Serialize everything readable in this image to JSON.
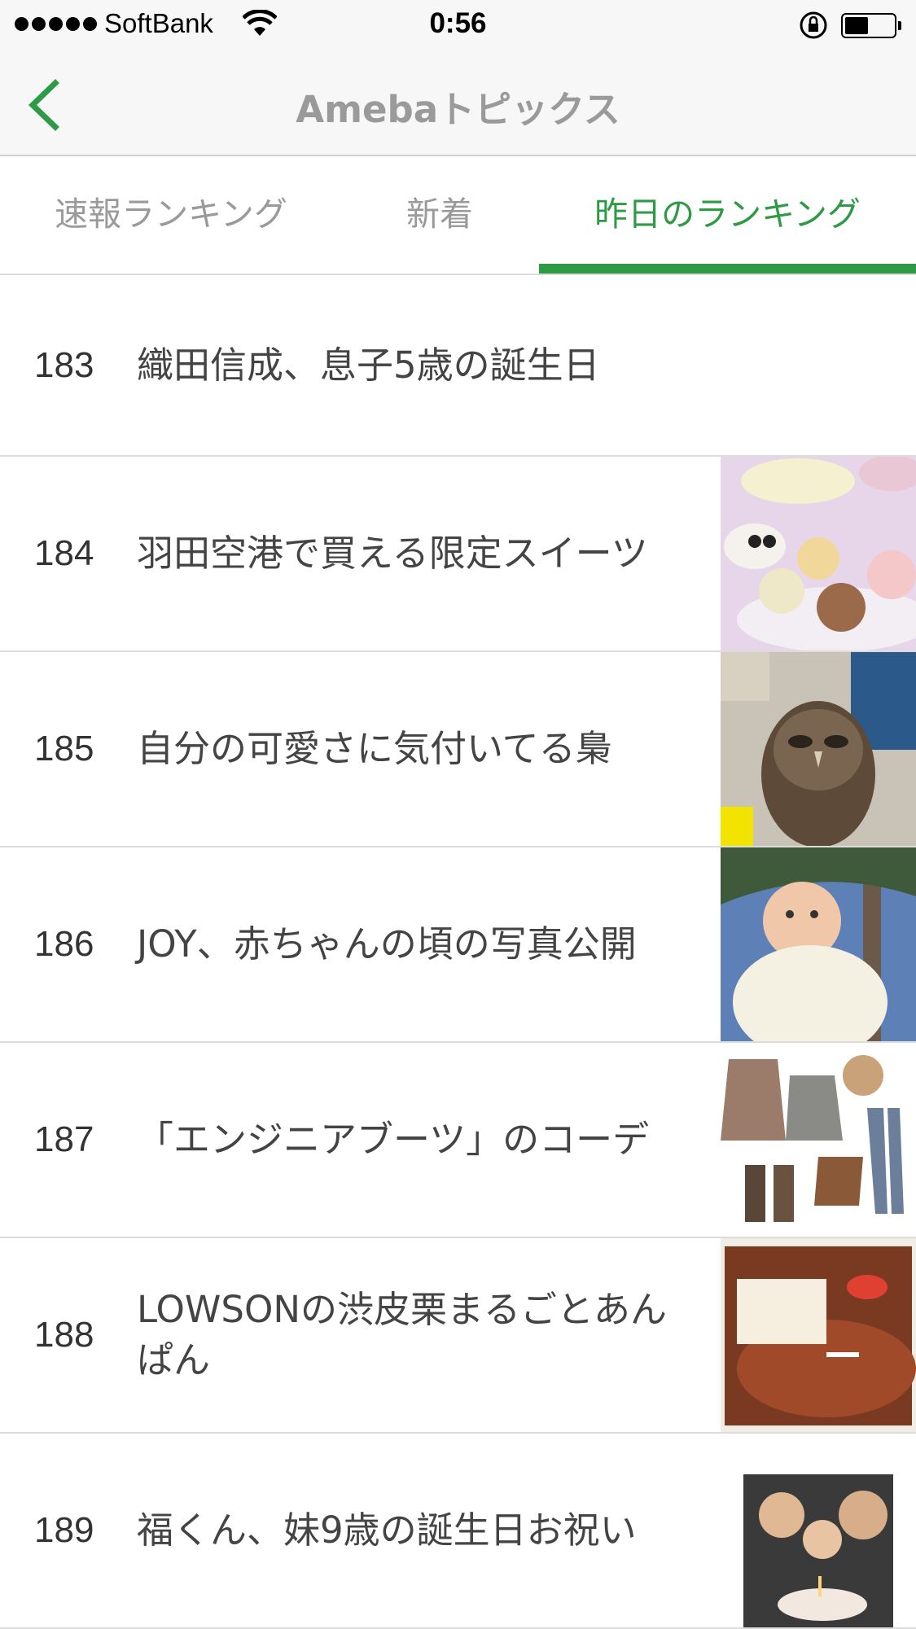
{
  "status_bar": {
    "carrier": "SoftBank",
    "time": "0:56"
  },
  "nav": {
    "title": "Amebaトピックス",
    "back_icon": "chevron-left-icon",
    "accent_color": "#2e9a46"
  },
  "tabs": [
    {
      "label": "速報ランキング",
      "selected": false
    },
    {
      "label": "新着",
      "selected": false
    },
    {
      "label": "昨日のランキング",
      "selected": true
    }
  ],
  "items": [
    {
      "rank": "183",
      "title": "織田信成、息子5歳の誕生日",
      "thumbnail": "none"
    },
    {
      "rank": "184",
      "title": "羽田空港で買える限定スイーツ",
      "thumbnail": "macarons-photo"
    },
    {
      "rank": "185",
      "title": "自分の可愛さに気付いてる梟",
      "thumbnail": "owl-photo"
    },
    {
      "rank": "186",
      "title": "JOY、赤ちゃんの頃の写真公開",
      "thumbnail": "baby-photo"
    },
    {
      "rank": "187",
      "title": "「エンジニアブーツ」のコーデ",
      "thumbnail": "fashion-photo"
    },
    {
      "rank": "188",
      "title": "LOWSONの渋皮栗まるごとあんぱん",
      "thumbnail": "bread-photo"
    },
    {
      "rank": "189",
      "title": "福くん、妹9歳の誕生日お祝い",
      "thumbnail": "birthday-photo"
    }
  ]
}
